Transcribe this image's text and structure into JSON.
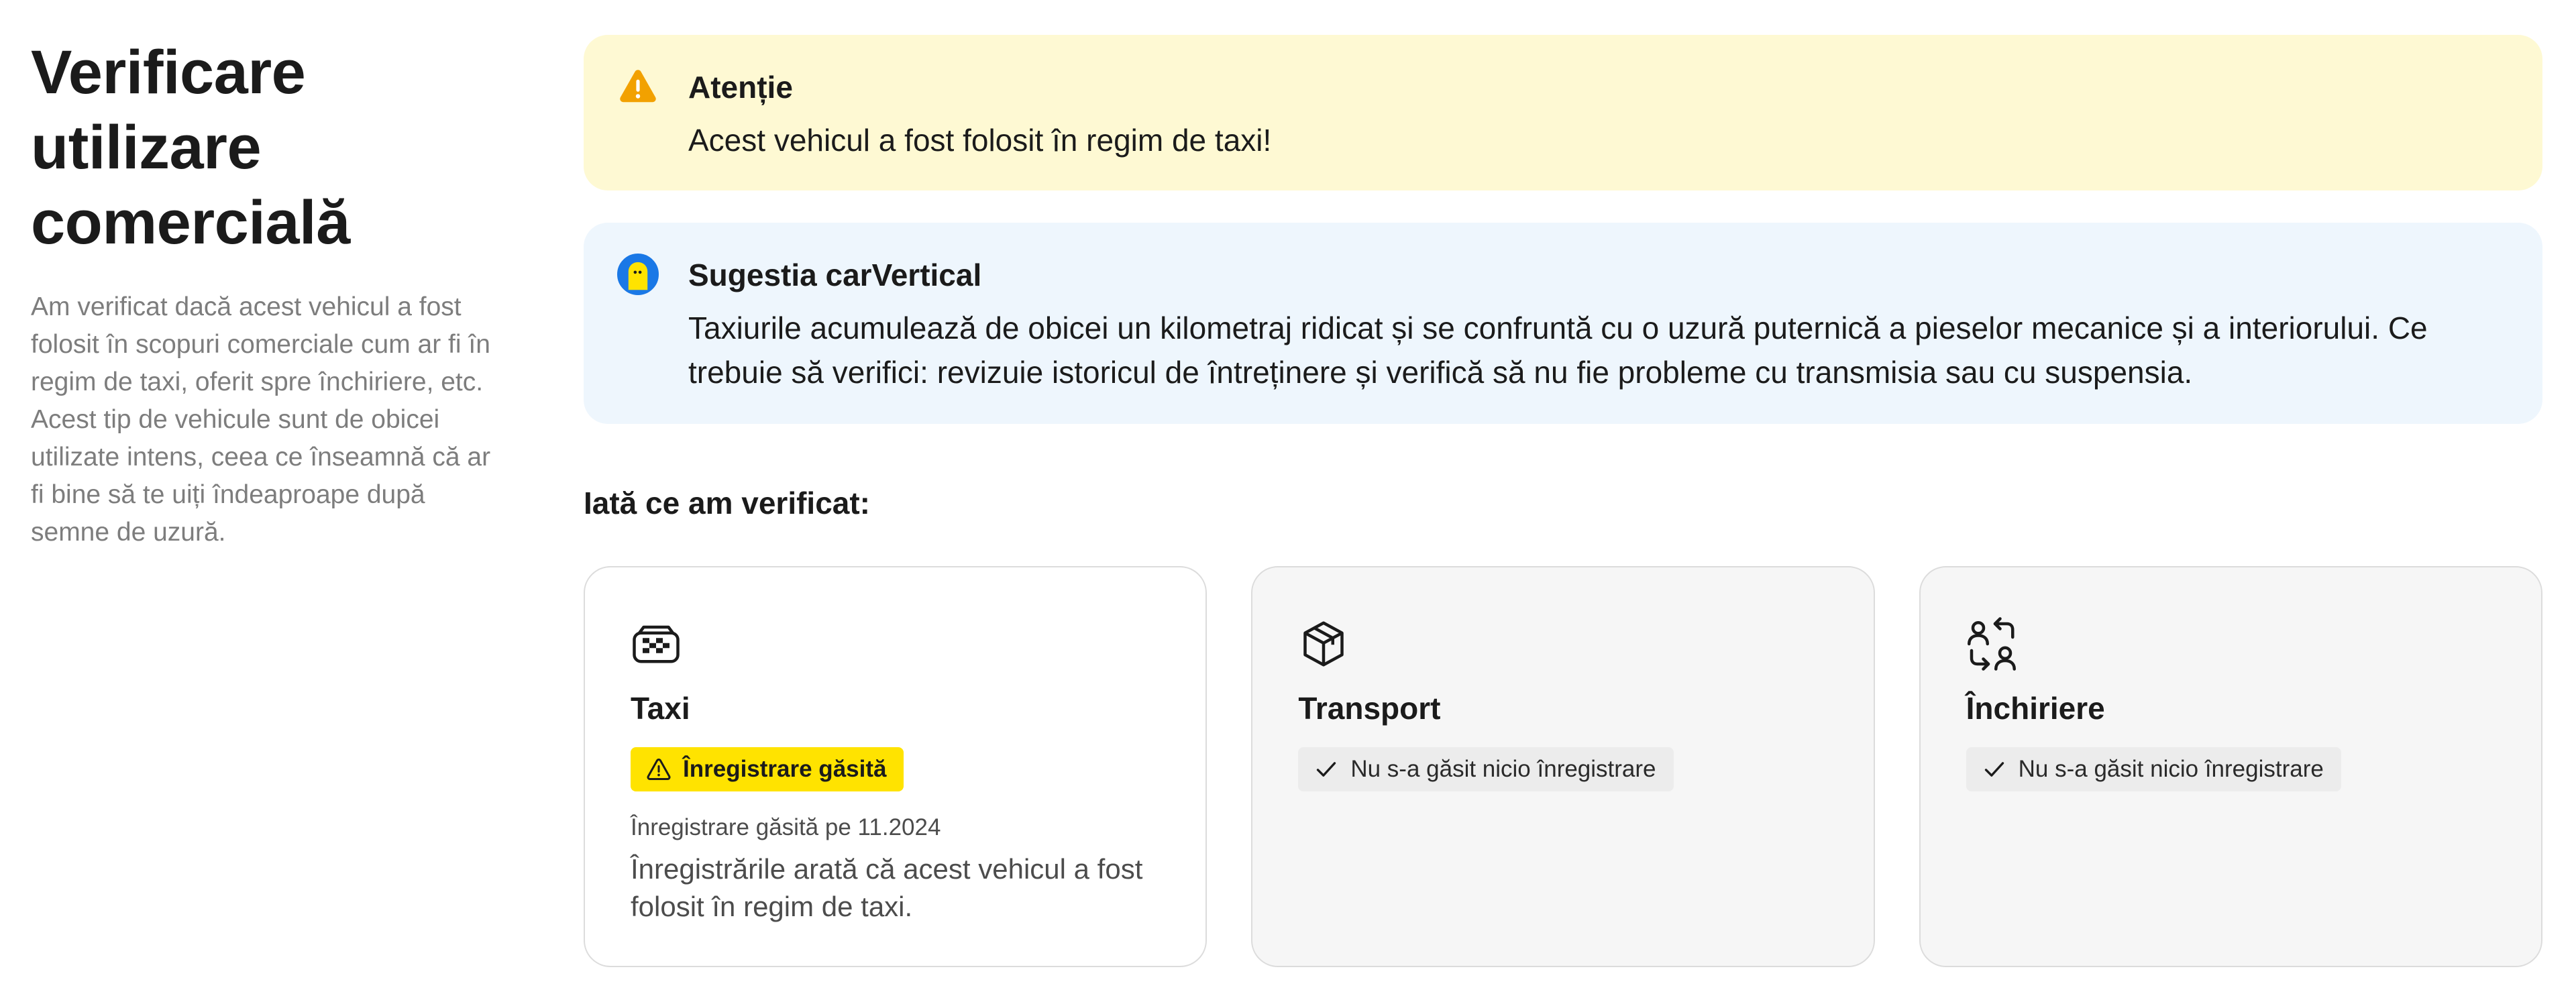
{
  "sidebar": {
    "title_line1": "Verificare",
    "title_line2": "utilizare",
    "title_line3": "comercială",
    "description": "Am verificat dacă acest vehicul a fost folosit în scopuri comerciale cum ar fi în regim de taxi, oferit spre închiriere, etc. Acest tip de vehicule sunt de obicei utilizate intens, ceea ce înseamnă că ar fi bine să te uiți îndeaproape după semne de uzură."
  },
  "alerts": {
    "warning": {
      "icon": "warning-triangle-icon",
      "title": "Atenție",
      "body": "Acest vehicul a fost folosit în regim de taxi!",
      "background": "#fef9d3",
      "icon_color": "#f2a100"
    },
    "suggestion": {
      "icon": "carvertical-mascot-icon",
      "title": "Sugestia carVertical",
      "body": "Taxiurile acumulează de obicei un kilometraj ridicat și se confruntă cu o uzură puternică a pieselor mecanice și a interiorului. Ce trebuie să verifici: revizuie istoricul de întreținere și verifică să nu fie probleme cu transmisia sau cu suspensia.",
      "background": "#eef6fd"
    }
  },
  "checks": {
    "heading": "Iată ce am verificat:",
    "items": [
      {
        "icon": "taxi-sign-icon",
        "title": "Taxi",
        "status": "Înregistrare găsită",
        "status_icon": "warning-triangle-icon",
        "meta": "Înregistrare găsită pe 11.2024",
        "text": "Înregistrările arată că acest vehicul a fost folosit în regim de taxi."
      },
      {
        "icon": "package-box-icon",
        "title": "Transport",
        "status": "Nu s-a găsit nicio înregistrare",
        "status_icon": "checkmark-icon"
      },
      {
        "icon": "people-exchange-icon",
        "title": "Închiriere",
        "status": "Nu s-a găsit nicio înregistrare",
        "status_icon": "checkmark-icon"
      }
    ]
  },
  "colors": {
    "badge_found": "#ffe300",
    "badge_none": "#ececec",
    "muted_text": "#7d7d7d"
  }
}
